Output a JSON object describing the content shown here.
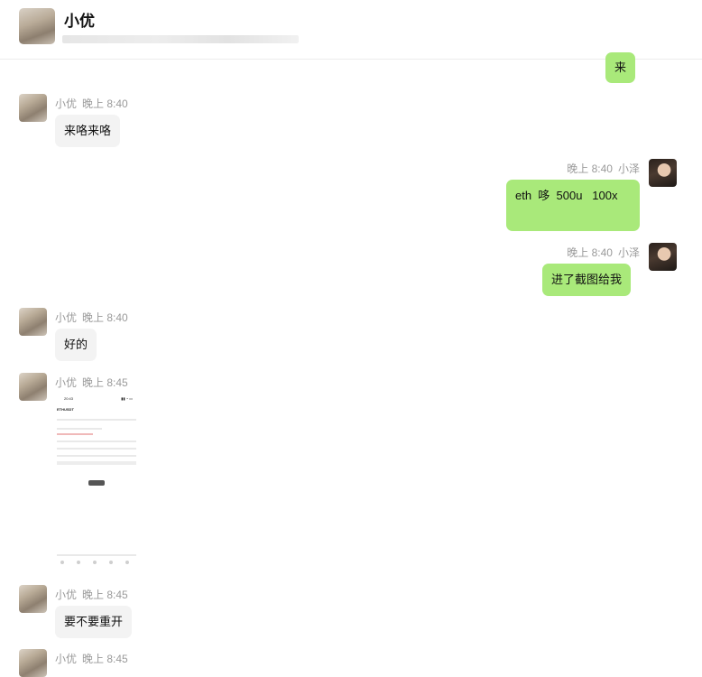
{
  "header": {
    "contact_name": "小优"
  },
  "messages": [
    {
      "sender": "me",
      "text": "来"
    },
    {
      "sender": "小优",
      "time": "晚上 8:40",
      "text": "来咯来咯"
    },
    {
      "sender": "小泽",
      "time": "晚上 8:40",
      "text": "eth  哆  500u   100x"
    },
    {
      "sender": "小泽",
      "time": "晚上 8:40",
      "text": "进了截图给我"
    },
    {
      "sender": "小优",
      "time": "晚上 8:40",
      "text": "好的"
    },
    {
      "sender": "小优",
      "time": "晚上 8:45",
      "image": {
        "time": "20:43",
        "symbol": "ETHUSDT"
      }
    },
    {
      "sender": "小优",
      "time": "晚上 8:45",
      "text": "要不要重开"
    },
    {
      "sender": "小优",
      "time": "晚上 8:45"
    }
  ],
  "colors": {
    "incoming_bubble": "#f3f3f3",
    "outgoing_bubble": "#a9e97a",
    "meta_text": "#9a9a9a"
  }
}
